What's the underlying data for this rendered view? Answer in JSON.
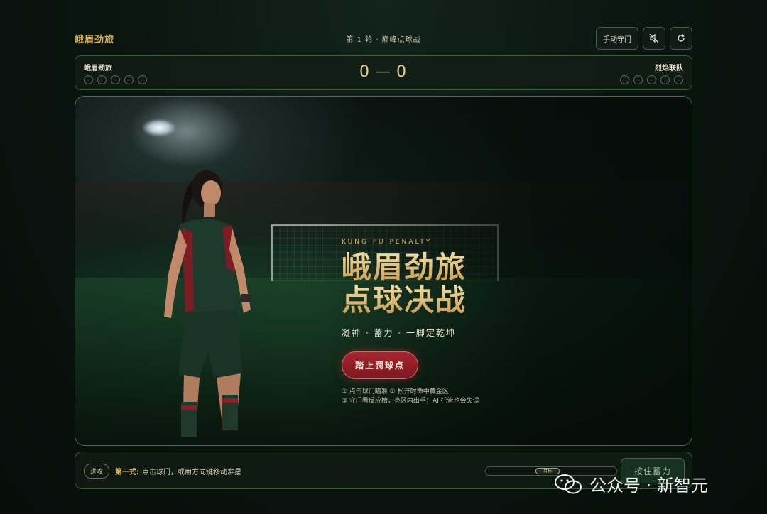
{
  "header": {
    "brand": "峨眉劲旅",
    "round": "第 1 轮 · 巅峰点球战",
    "manual_keeper": "手动守门"
  },
  "scoreboard": {
    "left_team": "峨眉劲旅",
    "right_team": "烈焰联队",
    "left_score": "0",
    "right_score": "0",
    "score_separator": "—",
    "left_attempts": [
      "-",
      "-",
      "-",
      "-",
      "-"
    ],
    "right_attempts": [
      "-",
      "-",
      "-",
      "-",
      "-"
    ]
  },
  "hero": {
    "kicker": "KUNG FU PENALTY",
    "title_line1": "峨眉劲旅",
    "title_line2": "点球决战",
    "tagline": "凝神 · 蓄力 · 一脚定乾坤",
    "cta": "踏上罚球点",
    "hint1": "① 点击球门瞄准   ② 松开时命中黄金区",
    "hint2": "③ 守门看反应槽，亮区内出手；AI 托管也会失误"
  },
  "bottom": {
    "phase": "进攻",
    "step_label": "第一式:",
    "instruction": "点击球门，或用方向键移动准星",
    "target_label": "目标",
    "hold_button": "按住蓄力",
    "power_level": 0
  },
  "watermark": {
    "text": "公众号 · 新智元"
  },
  "colors": {
    "accent_gold": "#e9cf8c",
    "cta_red": "#a8252f",
    "border_green": "#4d6f3d"
  },
  "icons": [
    "mute-icon",
    "refresh-icon",
    "wechat-icon"
  ]
}
